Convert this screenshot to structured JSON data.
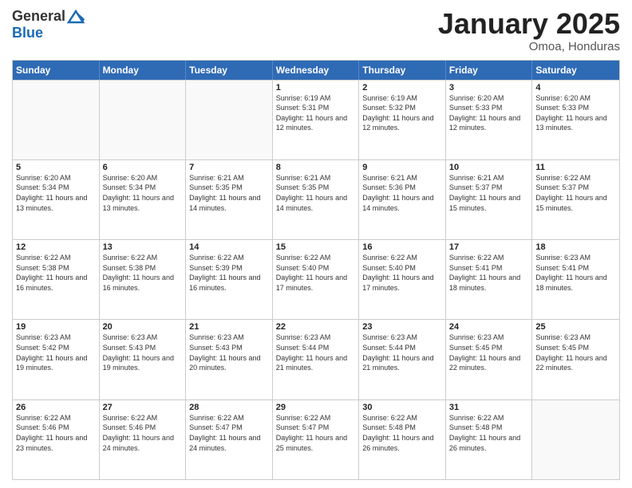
{
  "header": {
    "logo_general": "General",
    "logo_blue": "Blue",
    "title": "January 2025",
    "location": "Omoa, Honduras"
  },
  "weekdays": [
    "Sunday",
    "Monday",
    "Tuesday",
    "Wednesday",
    "Thursday",
    "Friday",
    "Saturday"
  ],
  "weeks": [
    [
      {
        "day": "",
        "sunrise": "",
        "sunset": "",
        "daylight": "",
        "empty": true
      },
      {
        "day": "",
        "sunrise": "",
        "sunset": "",
        "daylight": "",
        "empty": true
      },
      {
        "day": "",
        "sunrise": "",
        "sunset": "",
        "daylight": "",
        "empty": true
      },
      {
        "day": "1",
        "sunrise": "Sunrise: 6:19 AM",
        "sunset": "Sunset: 5:31 PM",
        "daylight": "Daylight: 11 hours and 12 minutes.",
        "empty": false
      },
      {
        "day": "2",
        "sunrise": "Sunrise: 6:19 AM",
        "sunset": "Sunset: 5:32 PM",
        "daylight": "Daylight: 11 hours and 12 minutes.",
        "empty": false
      },
      {
        "day": "3",
        "sunrise": "Sunrise: 6:20 AM",
        "sunset": "Sunset: 5:33 PM",
        "daylight": "Daylight: 11 hours and 12 minutes.",
        "empty": false
      },
      {
        "day": "4",
        "sunrise": "Sunrise: 6:20 AM",
        "sunset": "Sunset: 5:33 PM",
        "daylight": "Daylight: 11 hours and 13 minutes.",
        "empty": false
      }
    ],
    [
      {
        "day": "5",
        "sunrise": "Sunrise: 6:20 AM",
        "sunset": "Sunset: 5:34 PM",
        "daylight": "Daylight: 11 hours and 13 minutes.",
        "empty": false
      },
      {
        "day": "6",
        "sunrise": "Sunrise: 6:20 AM",
        "sunset": "Sunset: 5:34 PM",
        "daylight": "Daylight: 11 hours and 13 minutes.",
        "empty": false
      },
      {
        "day": "7",
        "sunrise": "Sunrise: 6:21 AM",
        "sunset": "Sunset: 5:35 PM",
        "daylight": "Daylight: 11 hours and 14 minutes.",
        "empty": false
      },
      {
        "day": "8",
        "sunrise": "Sunrise: 6:21 AM",
        "sunset": "Sunset: 5:35 PM",
        "daylight": "Daylight: 11 hours and 14 minutes.",
        "empty": false
      },
      {
        "day": "9",
        "sunrise": "Sunrise: 6:21 AM",
        "sunset": "Sunset: 5:36 PM",
        "daylight": "Daylight: 11 hours and 14 minutes.",
        "empty": false
      },
      {
        "day": "10",
        "sunrise": "Sunrise: 6:21 AM",
        "sunset": "Sunset: 5:37 PM",
        "daylight": "Daylight: 11 hours and 15 minutes.",
        "empty": false
      },
      {
        "day": "11",
        "sunrise": "Sunrise: 6:22 AM",
        "sunset": "Sunset: 5:37 PM",
        "daylight": "Daylight: 11 hours and 15 minutes.",
        "empty": false
      }
    ],
    [
      {
        "day": "12",
        "sunrise": "Sunrise: 6:22 AM",
        "sunset": "Sunset: 5:38 PM",
        "daylight": "Daylight: 11 hours and 16 minutes.",
        "empty": false
      },
      {
        "day": "13",
        "sunrise": "Sunrise: 6:22 AM",
        "sunset": "Sunset: 5:38 PM",
        "daylight": "Daylight: 11 hours and 16 minutes.",
        "empty": false
      },
      {
        "day": "14",
        "sunrise": "Sunrise: 6:22 AM",
        "sunset": "Sunset: 5:39 PM",
        "daylight": "Daylight: 11 hours and 16 minutes.",
        "empty": false
      },
      {
        "day": "15",
        "sunrise": "Sunrise: 6:22 AM",
        "sunset": "Sunset: 5:40 PM",
        "daylight": "Daylight: 11 hours and 17 minutes.",
        "empty": false
      },
      {
        "day": "16",
        "sunrise": "Sunrise: 6:22 AM",
        "sunset": "Sunset: 5:40 PM",
        "daylight": "Daylight: 11 hours and 17 minutes.",
        "empty": false
      },
      {
        "day": "17",
        "sunrise": "Sunrise: 6:22 AM",
        "sunset": "Sunset: 5:41 PM",
        "daylight": "Daylight: 11 hours and 18 minutes.",
        "empty": false
      },
      {
        "day": "18",
        "sunrise": "Sunrise: 6:23 AM",
        "sunset": "Sunset: 5:41 PM",
        "daylight": "Daylight: 11 hours and 18 minutes.",
        "empty": false
      }
    ],
    [
      {
        "day": "19",
        "sunrise": "Sunrise: 6:23 AM",
        "sunset": "Sunset: 5:42 PM",
        "daylight": "Daylight: 11 hours and 19 minutes.",
        "empty": false
      },
      {
        "day": "20",
        "sunrise": "Sunrise: 6:23 AM",
        "sunset": "Sunset: 5:43 PM",
        "daylight": "Daylight: 11 hours and 19 minutes.",
        "empty": false
      },
      {
        "day": "21",
        "sunrise": "Sunrise: 6:23 AM",
        "sunset": "Sunset: 5:43 PM",
        "daylight": "Daylight: 11 hours and 20 minutes.",
        "empty": false
      },
      {
        "day": "22",
        "sunrise": "Sunrise: 6:23 AM",
        "sunset": "Sunset: 5:44 PM",
        "daylight": "Daylight: 11 hours and 21 minutes.",
        "empty": false
      },
      {
        "day": "23",
        "sunrise": "Sunrise: 6:23 AM",
        "sunset": "Sunset: 5:44 PM",
        "daylight": "Daylight: 11 hours and 21 minutes.",
        "empty": false
      },
      {
        "day": "24",
        "sunrise": "Sunrise: 6:23 AM",
        "sunset": "Sunset: 5:45 PM",
        "daylight": "Daylight: 11 hours and 22 minutes.",
        "empty": false
      },
      {
        "day": "25",
        "sunrise": "Sunrise: 6:23 AM",
        "sunset": "Sunset: 5:45 PM",
        "daylight": "Daylight: 11 hours and 22 minutes.",
        "empty": false
      }
    ],
    [
      {
        "day": "26",
        "sunrise": "Sunrise: 6:22 AM",
        "sunset": "Sunset: 5:46 PM",
        "daylight": "Daylight: 11 hours and 23 minutes.",
        "empty": false
      },
      {
        "day": "27",
        "sunrise": "Sunrise: 6:22 AM",
        "sunset": "Sunset: 5:46 PM",
        "daylight": "Daylight: 11 hours and 24 minutes.",
        "empty": false
      },
      {
        "day": "28",
        "sunrise": "Sunrise: 6:22 AM",
        "sunset": "Sunset: 5:47 PM",
        "daylight": "Daylight: 11 hours and 24 minutes.",
        "empty": false
      },
      {
        "day": "29",
        "sunrise": "Sunrise: 6:22 AM",
        "sunset": "Sunset: 5:47 PM",
        "daylight": "Daylight: 11 hours and 25 minutes.",
        "empty": false
      },
      {
        "day": "30",
        "sunrise": "Sunrise: 6:22 AM",
        "sunset": "Sunset: 5:48 PM",
        "daylight": "Daylight: 11 hours and 26 minutes.",
        "empty": false
      },
      {
        "day": "31",
        "sunrise": "Sunrise: 6:22 AM",
        "sunset": "Sunset: 5:48 PM",
        "daylight": "Daylight: 11 hours and 26 minutes.",
        "empty": false
      },
      {
        "day": "",
        "sunrise": "",
        "sunset": "",
        "daylight": "",
        "empty": true
      }
    ]
  ]
}
